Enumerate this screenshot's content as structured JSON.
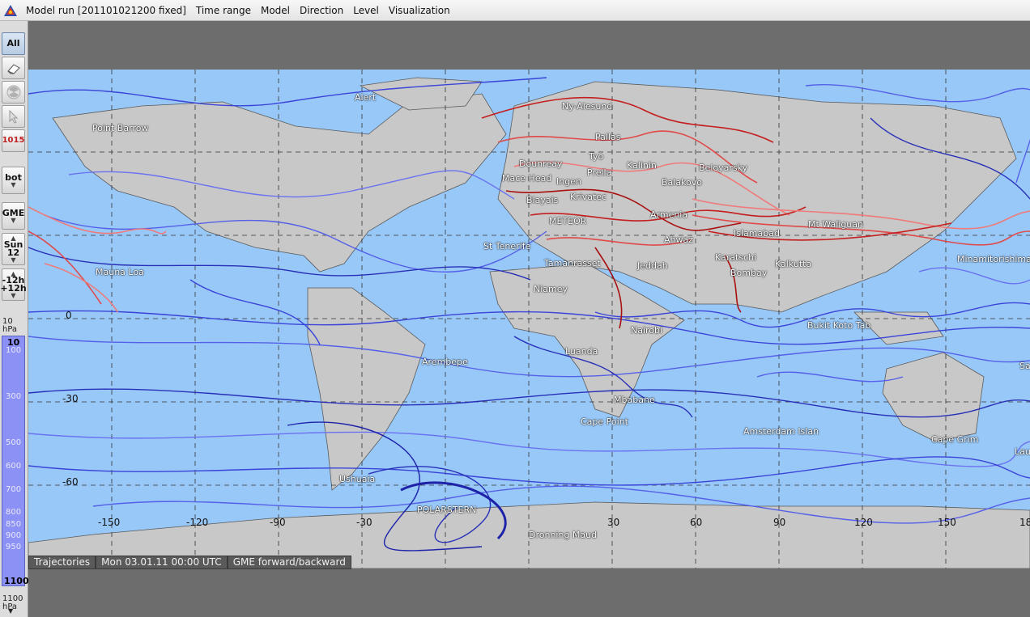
{
  "menubar": {
    "app_icon": "app-logo-icon",
    "items": [
      "Model run [201101021200 fixed]",
      "Time range",
      "Model",
      "Direction",
      "Level",
      "Visualization"
    ]
  },
  "toolbar": {
    "all": "All",
    "eraser_icon": "eraser-icon",
    "radiation_icon": "radiation-icon",
    "cursor_icon": "cursor-icon",
    "isobar": "1015",
    "bottom": "bot",
    "model": "GME",
    "day": "Sun",
    "hour": "12",
    "step_back": "-12h",
    "step_fwd": "+12h"
  },
  "level_scale": {
    "top_value": "10",
    "top_unit": "hPa",
    "selected_top": "10",
    "ticks": [
      "100",
      "300",
      "500",
      "600",
      "700",
      "800",
      "850",
      "900",
      "950"
    ],
    "selected_bottom": "1100",
    "bottom_value": "1100",
    "bottom_unit": "hPa"
  },
  "map": {
    "ocean_color": "#98c8f8",
    "land_color": "#c8c8c8",
    "lat_labels": [
      "0",
      "-30",
      "-60"
    ],
    "lon_labels": [
      "-150",
      "-120",
      "-90",
      "-60",
      "-30",
      "0",
      "30",
      "60",
      "90",
      "120",
      "150",
      "18"
    ],
    "stations": [
      "Alert",
      "Point Barrow",
      "Ny-Alesund",
      "Pallas",
      "Dounreay",
      "Tyo",
      "Kalinin",
      "Beloyarsky",
      "Mace Head",
      "Ingen",
      "Prella",
      "Balakovo",
      "Blayais",
      "Krivatec",
      "METEOR",
      "Armenia",
      "Islamabad",
      "Mt Waliguan",
      "St Tenerife",
      "Ahwaz",
      "Karatschi",
      "Kalkutta",
      "Tamanrasset",
      "Jeddah",
      "Bombay",
      "Minamitorishima",
      "Mauna Loa",
      "Niamey",
      "Nairobi",
      "Bukit Koto Tab",
      "Arembepe",
      "Luanda",
      "Mbabane",
      "Sa",
      "Cape Point",
      "Amsterdam Islan",
      "Cape Grim",
      "Lau",
      "Ushuaia",
      "POLARSTERN",
      "Dronning Maud"
    ]
  },
  "status": {
    "label": "Trajectories",
    "time": "Mon 03.01.11 00:00 UTC",
    "model": "GME forward/backward"
  }
}
